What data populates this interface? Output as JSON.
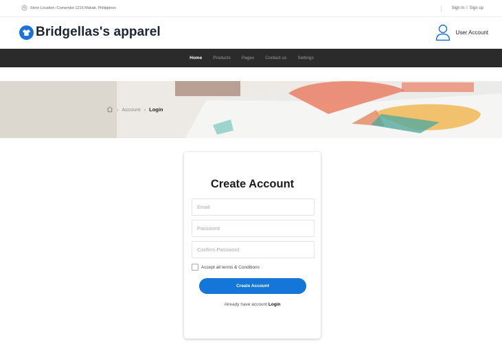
{
  "topbar": {
    "store_location": "Store Location: Comembo 1216 Makati, Philippines",
    "sign_in": "Sign in",
    "divider": "/",
    "sign_up": "Sign up"
  },
  "header": {
    "brand": "Bridgellas's apparel",
    "user_account": "User Account"
  },
  "nav": {
    "items": [
      {
        "label": "Home"
      },
      {
        "label": "Products"
      },
      {
        "label": "Pages"
      },
      {
        "label": "Contact us"
      },
      {
        "label": "Settings"
      }
    ]
  },
  "breadcrumb": {
    "account": "Account",
    "current": "Login"
  },
  "form": {
    "title": "Create Account",
    "email_placeholder": "Email",
    "password_placeholder": "Password",
    "confirm_placeholder": "Confirm Password",
    "terms_label": "Accept all terms & Conditions",
    "submit_label": "Create Account",
    "already_text": "Already have account",
    "login_link": "Login"
  },
  "colors": {
    "accent": "#1476d8",
    "nav_bg": "#2b2b2b",
    "brand_text": "#1e2533"
  }
}
